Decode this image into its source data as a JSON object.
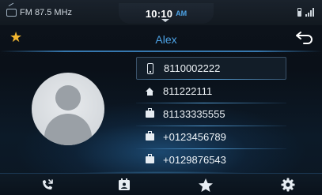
{
  "status_bar": {
    "radio_label": "FM 87.5 MHz",
    "time": "10:10",
    "ampm": "AM",
    "icons": [
      "radio-icon",
      "battery-icon",
      "signal-icon"
    ]
  },
  "header": {
    "contact_name": "Alex",
    "favorite_icon": "star-icon",
    "back_icon": "back-arrow-icon"
  },
  "contact": {
    "avatar_icon": "avatar-placeholder-icon",
    "numbers": [
      {
        "type_icon": "mobile-icon",
        "number": "8110002222",
        "selected": true
      },
      {
        "type_icon": "home-icon",
        "number": "811222111",
        "selected": false
      },
      {
        "type_icon": "work-icon",
        "number": "81133335555",
        "selected": false
      },
      {
        "type_icon": "work-icon",
        "number": "+0123456789",
        "selected": false
      },
      {
        "type_icon": "work-icon",
        "number": "+0129876543",
        "selected": false
      }
    ]
  },
  "bottom_bar": {
    "items": [
      {
        "icon": "recent-calls-icon"
      },
      {
        "icon": "contacts-book-icon"
      },
      {
        "icon": "favorites-star-icon"
      },
      {
        "icon": "settings-gear-icon"
      }
    ]
  },
  "colors": {
    "accent": "#4da3e6",
    "star": "#f2b630",
    "background": "#0a0f17"
  }
}
